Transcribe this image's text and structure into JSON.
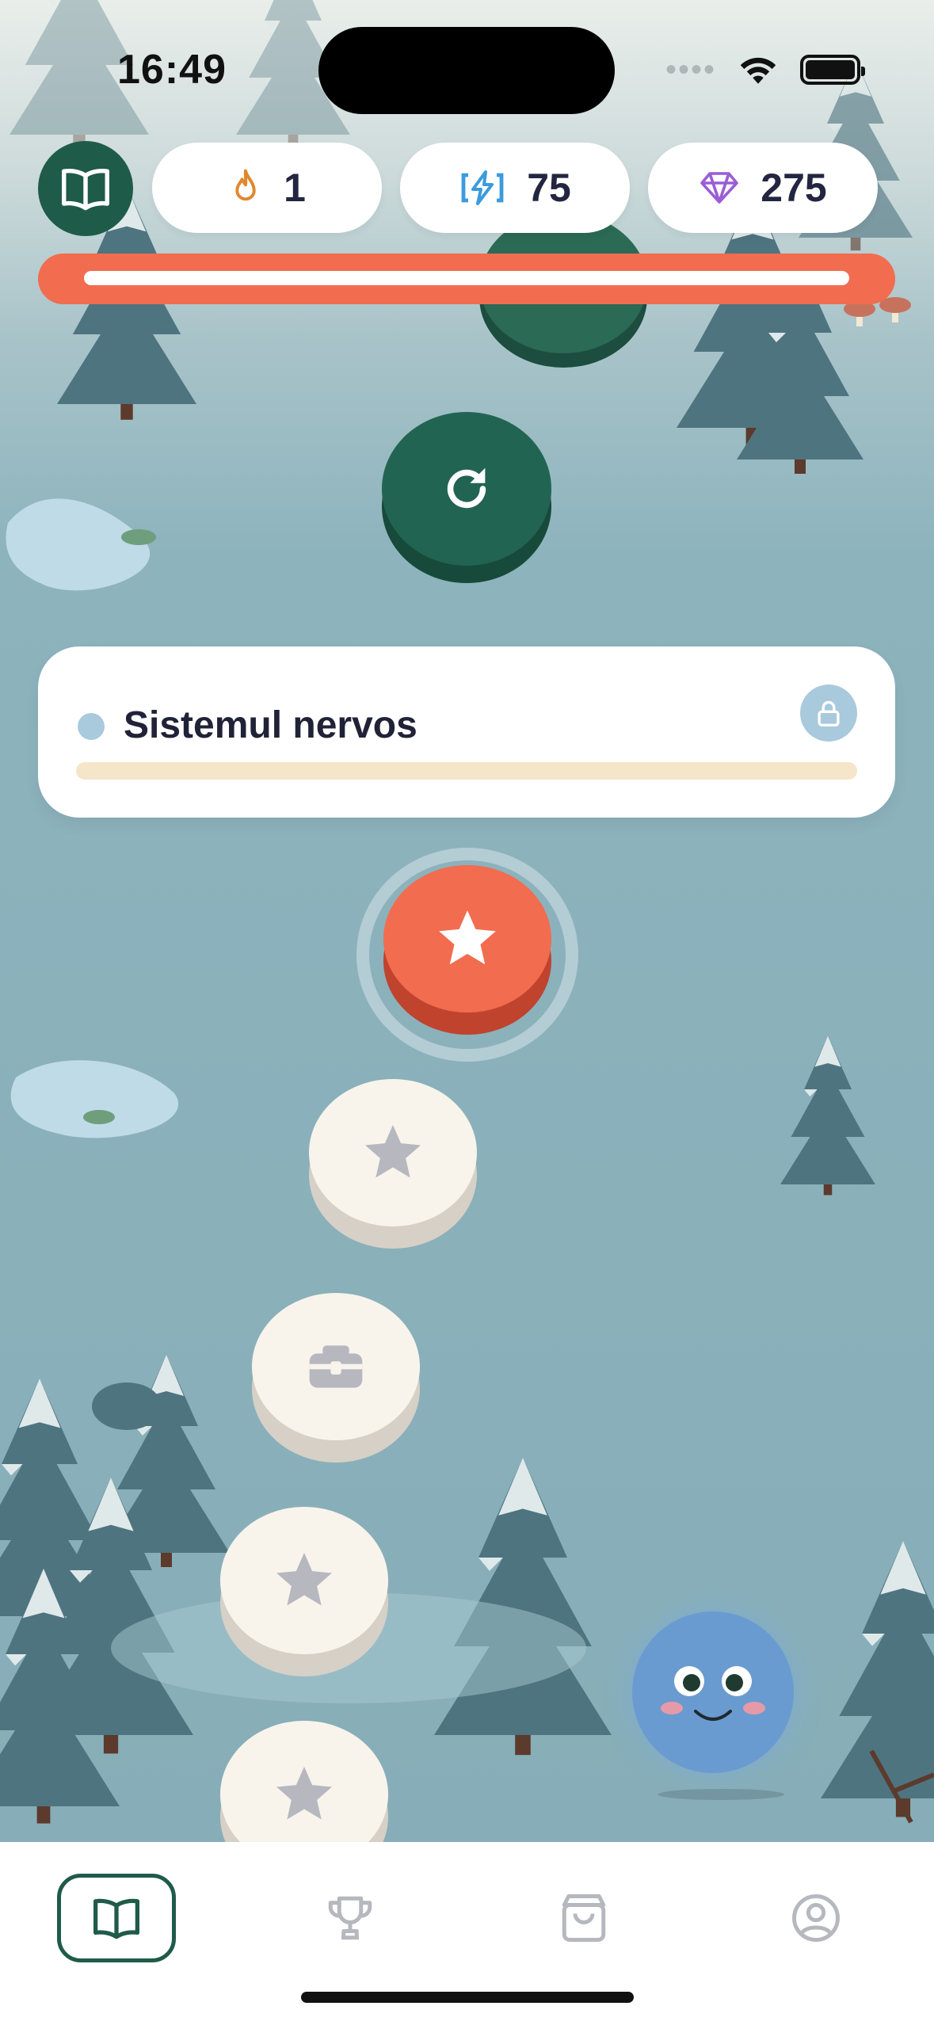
{
  "status_bar": {
    "time": "16:49"
  },
  "header": {
    "streak_count": "1",
    "energy_count": "75",
    "gems_count": "275",
    "level_progress": 1.0
  },
  "unit": {
    "title": "Sistemul nervos",
    "progress": 0.0
  },
  "path_nodes": [
    {
      "type": "review",
      "state": "completed"
    },
    {
      "type": "star",
      "state": "current"
    },
    {
      "type": "star",
      "state": "locked"
    },
    {
      "type": "chest",
      "state": "locked"
    },
    {
      "type": "star",
      "state": "locked"
    },
    {
      "type": "star",
      "state": "locked"
    }
  ],
  "nav": {
    "items": [
      {
        "name": "learn",
        "icon": "book-icon",
        "active": true
      },
      {
        "name": "leaderboard",
        "icon": "trophy-icon",
        "active": false
      },
      {
        "name": "shop",
        "icon": "shopping-bag-icon",
        "active": false
      },
      {
        "name": "profile",
        "icon": "user-icon",
        "active": false
      }
    ]
  },
  "colors": {
    "brand_green": "#1f5b49",
    "accent_orange": "#f26c4f",
    "locked_node": "#f8f4ec",
    "unit_dot": "#a9c9dd"
  }
}
